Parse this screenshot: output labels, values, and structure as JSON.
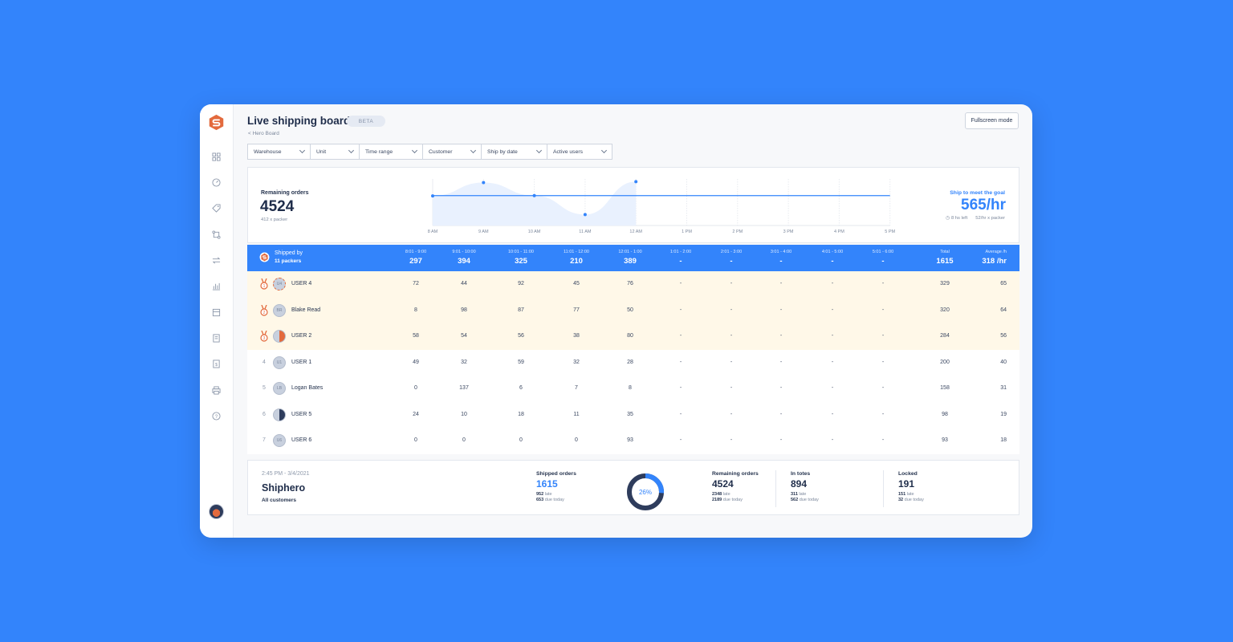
{
  "app": {
    "title": "Live shipping board",
    "badge": "BETA",
    "back_link": "< Hero Board",
    "fullscreen_label": "Fullscreen mode"
  },
  "sidebar": {
    "icons": [
      "grid-icon",
      "dashboard-icon",
      "tag-icon",
      "routing-icon",
      "transfer-icon",
      "chart-icon",
      "box-icon",
      "document-icon",
      "invoice-icon",
      "printer-icon",
      "help-icon"
    ]
  },
  "filters": [
    {
      "label": "Warehouse"
    },
    {
      "label": "Unit"
    },
    {
      "label": "Time range"
    },
    {
      "label": "Customer"
    },
    {
      "label": "Ship by date"
    },
    {
      "label": "Active users"
    }
  ],
  "summary": {
    "remaining_label": "Remaining orders",
    "remaining_value": "4524",
    "remaining_sub": "412 x packer",
    "goal_label": "Ship to meet the goal",
    "goal_value": "565/hr",
    "goal_time_left": "8 hs left",
    "goal_per_packer": "52/hr x packer"
  },
  "chart_data": {
    "type": "area",
    "x": [
      "8 AM",
      "9 AM",
      "10 AM",
      "11 AM",
      "12 AM",
      "1 PM",
      "2 PM",
      "3 PM",
      "4 PM",
      "5 PM"
    ],
    "series": [
      {
        "values": [
          389,
          429,
          390,
          333,
          432,
          null,
          null,
          null,
          null,
          null
        ]
      }
    ],
    "goal_line": 390
  },
  "table": {
    "shipped_by_label": "Shipped by",
    "packers_label": "11 packers",
    "columns": [
      {
        "label": "8:01 - 9:00",
        "value": "297"
      },
      {
        "label": "9:01 - 10:00",
        "value": "394"
      },
      {
        "label": "10:01 - 11:00",
        "value": "325"
      },
      {
        "label": "11:01 - 12:00",
        "value": "210"
      },
      {
        "label": "12:01 - 1:00",
        "value": "389"
      },
      {
        "label": "1:01 - 2:00",
        "value": "-"
      },
      {
        "label": "2:01 - 3:00",
        "value": "-"
      },
      {
        "label": "3:01 - 4:00",
        "value": "-"
      },
      {
        "label": "4:01 - 5:00",
        "value": "-"
      },
      {
        "label": "5:01 - 6:00",
        "value": "-"
      }
    ],
    "total": {
      "label": "Total",
      "value": "1615"
    },
    "average": {
      "label": "Average /h",
      "value": "318 /hr"
    },
    "rows": [
      {
        "rank": "1",
        "initials": "U4",
        "name": "USER 4",
        "values": [
          "72",
          "44",
          "92",
          "45",
          "76",
          "-",
          "-",
          "-",
          "-",
          "-"
        ],
        "total": "329",
        "avg": "65"
      },
      {
        "rank": "2",
        "initials": "BR",
        "name": "Blake Read",
        "values": [
          "8",
          "98",
          "87",
          "77",
          "50",
          "-",
          "-",
          "-",
          "-",
          "-"
        ],
        "total": "320",
        "avg": "64"
      },
      {
        "rank": "3",
        "initials": "",
        "name": "USER 2",
        "values": [
          "58",
          "54",
          "56",
          "38",
          "80",
          "-",
          "-",
          "-",
          "-",
          "-"
        ],
        "total": "284",
        "avg": "56"
      },
      {
        "rank": "4",
        "initials": "U1",
        "name": "USER 1",
        "values": [
          "49",
          "32",
          "59",
          "32",
          "28",
          "-",
          "-",
          "-",
          "-",
          "-"
        ],
        "total": "200",
        "avg": "40"
      },
      {
        "rank": "5",
        "initials": "LB",
        "name": "Logan Bates",
        "values": [
          "0",
          "137",
          "6",
          "7",
          "8",
          "-",
          "-",
          "-",
          "-",
          "-"
        ],
        "total": "158",
        "avg": "31"
      },
      {
        "rank": "6",
        "initials": "",
        "name": "USER 5",
        "values": [
          "24",
          "10",
          "18",
          "11",
          "35",
          "-",
          "-",
          "-",
          "-",
          "-"
        ],
        "total": "98",
        "avg": "19"
      },
      {
        "rank": "7",
        "initials": "U6",
        "name": "USER 6",
        "values": [
          "0",
          "0",
          "0",
          "0",
          "93",
          "-",
          "-",
          "-",
          "-",
          "-"
        ],
        "total": "93",
        "avg": "18"
      }
    ]
  },
  "footer": {
    "datetime": "2:45 PM - 3/4/2021",
    "account": "Shiphero",
    "customers": "All customers",
    "shipped": {
      "label": "Shipped orders",
      "value": "1615",
      "late": "952",
      "late_label": "late",
      "due": "653",
      "due_label": "due today"
    },
    "donut": {
      "percent_label": "26%",
      "fraction": 0.26
    },
    "remaining": {
      "label": "Remaining orders",
      "value": "4524",
      "late": "2348",
      "late_label": "late",
      "due": "2189",
      "due_label": "due today"
    },
    "in_totes": {
      "label": "In totes",
      "value": "894",
      "late": "311",
      "late_label": "late",
      "due": "562",
      "due_label": "due today"
    },
    "locked": {
      "label": "Locked",
      "value": "191",
      "late": "151",
      "late_label": "late",
      "due": "32",
      "due_label": "due today"
    }
  },
  "colors": {
    "accent": "#3384fb",
    "highlight_row": "#fff8e8",
    "medal": "#e36a3d",
    "navy": "#2e3c5c"
  }
}
